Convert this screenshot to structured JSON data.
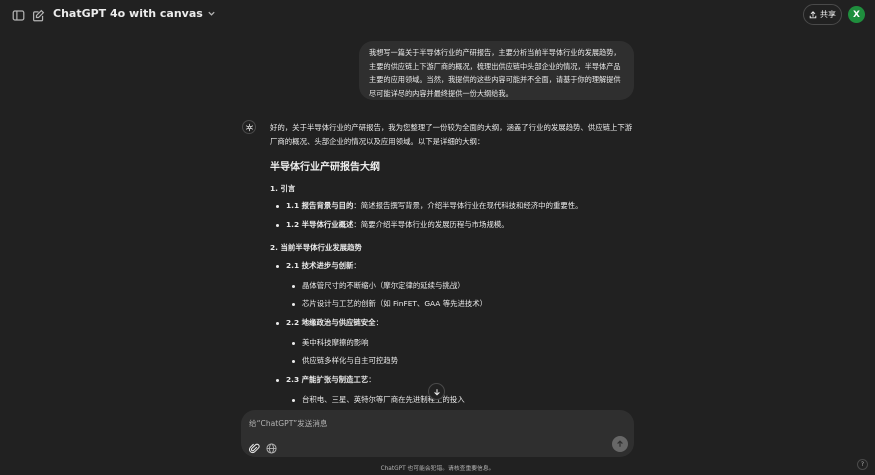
{
  "header": {
    "model_title": "ChatGPT 4o with canvas",
    "share_label": "共享",
    "avatar_letter": "X"
  },
  "user_message": "我想写一篇关于半导体行业的产研报告，主要分析当前半导体行业的发展趋势，主要的供应链上下游厂商的概况，梳理出供应链中头部企业的情况，半导体产品主要的应用领域。当然，我提供的这些内容可能并不全面，请基于你的理解提供尽可能详尽的内容并最终提供一份大纲给我。",
  "assistant": {
    "intro": "好的，关于半导体行业的产研报告，我为您整理了一份较为全面的大纲，涵盖了行业的发展趋势、供应链上下游厂商的概况、头部企业的情况以及应用领域。以下是详细的大纲：",
    "outline_title": "半导体行业产研报告大纲",
    "sections": [
      {
        "title": "1. 引言",
        "items": [
          {
            "label": "1.1 报告背景与目的",
            "text": "：简述报告撰写背景，介绍半导体行业在现代科技和经济中的重要性。"
          },
          {
            "label": "1.2 半导体行业概述",
            "text": "：简要介绍半导体行业的发展历程与市场规模。"
          }
        ]
      },
      {
        "title": "2. 当前半导体行业发展趋势",
        "items": [
          {
            "label": "2.1 技术进步与创新",
            "text": "：",
            "subitems": [
              "晶体管尺寸的不断缩小（摩尔定律的延续与挑战）",
              "芯片设计与工艺的创新（如 FinFET、GAA 等先进技术）"
            ]
          },
          {
            "label": "2.2 地缘政治与供应链安全",
            "text": "：",
            "subitems": [
              "美中科技摩擦的影响",
              "供应链多样化与自主可控趋势"
            ]
          },
          {
            "label": "2.3 产能扩张与制造工艺",
            "text": "：",
            "subitems": [
              "台积电、三星、英特尔等厂商在先进制程上的投入"
            ]
          }
        ]
      }
    ]
  },
  "composer": {
    "placeholder": "给“ChatGPT”发送消息"
  },
  "footer": {
    "disclaimer": "ChatGPT 也可能会犯错。请核查重要信息。",
    "help": "?"
  }
}
